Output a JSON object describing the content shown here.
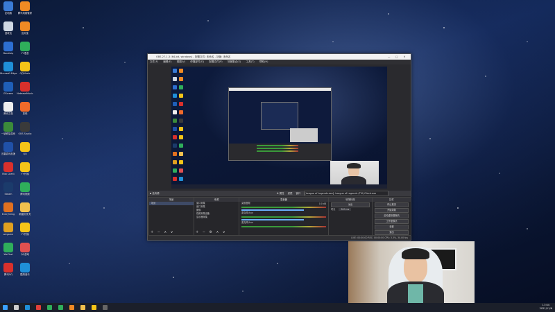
{
  "desktop_icons": [
    {
      "label": "此电脑",
      "icon": "computer-icon",
      "color": "#3a7bd5"
    },
    {
      "label": "腾讯电脑管家",
      "icon": "app-icon",
      "color": "#f08a24"
    },
    {
      "label": "回收站",
      "icon": "recycle-bin-icon",
      "color": "#cfd8e3"
    },
    {
      "label": "应用宝",
      "icon": "app-icon",
      "color": "#f08a24"
    },
    {
      "label": "Bandizip",
      "icon": "archive-icon",
      "color": "#2d6fd2"
    },
    {
      "label": "YY语音",
      "icon": "app-icon",
      "color": "#2fae5b"
    },
    {
      "label": "Microsoft Edge",
      "icon": "edge-icon",
      "color": "#1f8fd8"
    },
    {
      "label": "QQMusic",
      "icon": "music-icon",
      "color": "#f5c518"
    },
    {
      "label": "GScreen",
      "icon": "app-icon",
      "color": "#1f5fb8"
    },
    {
      "label": "NeteaseMusic",
      "icon": "music-icon",
      "color": "#d9302c"
    },
    {
      "label": "腾讯文档",
      "icon": "doc-icon",
      "color": "#eeeeee"
    },
    {
      "label": "剪映",
      "icon": "app-icon",
      "color": "#f06a2a"
    },
    {
      "label": "一键修复游戏",
      "icon": "app-icon",
      "color": "#3b8a3a"
    },
    {
      "label": "OBS Studio",
      "icon": "obs-icon",
      "color": "#3a3a3a"
    },
    {
      "label": "迅雷游戏加速",
      "icon": "app-icon",
      "color": "#2051a8"
    },
    {
      "label": "QQ",
      "icon": "app-icon",
      "color": "#f5c518"
    },
    {
      "label": "Riot Client",
      "icon": "app-icon",
      "color": "#d9302c"
    },
    {
      "label": "YY开播",
      "icon": "app-icon",
      "color": "#f5c518"
    },
    {
      "label": "Steam",
      "icon": "steam-icon",
      "color": "#1b3b6b"
    },
    {
      "label": "腾讯视频",
      "icon": "video-icon",
      "color": "#2fae5b"
    },
    {
      "label": "Everything",
      "icon": "search-icon",
      "color": "#e07020"
    },
    {
      "label": "新建文件夹",
      "icon": "folder-icon",
      "color": "#f2c14e"
    },
    {
      "label": "wegame",
      "icon": "app-icon",
      "color": "#e0a020"
    },
    {
      "label": "YY开播",
      "icon": "app-icon",
      "color": "#f5c518"
    },
    {
      "label": "WeChat",
      "icon": "wechat-icon",
      "color": "#2fae5b"
    },
    {
      "label": "QQ游戏",
      "icon": "app-icon",
      "color": "#e05050"
    },
    {
      "label": "腾讯QQ",
      "icon": "app-icon",
      "color": "#d9302c"
    },
    {
      "label": "酷狗音乐",
      "icon": "music-icon",
      "color": "#1f8fd8"
    }
  ],
  "obs": {
    "title": "OBS 27.1.3 (64-bit, windows) - 配置文件: 未命名 - 场景: 未命名",
    "window_buttons": [
      "—",
      "□",
      "✕"
    ],
    "menu": [
      "文件(F)",
      "编辑(E)",
      "视图(V)",
      "停靠部件(D)",
      "配置文件(P)",
      "场景集合(S)",
      "工具(T)",
      "帮助(H)"
    ],
    "scene_bar": {
      "left": "▪ 没有源",
      "props": "⚙ 属性",
      "filters": "滤镜",
      "window": "窗口",
      "window_value": "[League of Legends.exe]: League of Legends (TM) Client.exe"
    },
    "docks": {
      "scenes": {
        "title": "场景",
        "items": [
          "场景"
        ],
        "foot": "+ − ∧ ∨"
      },
      "sources": {
        "title": "来源",
        "items": [
          "窗口采集",
          "窗口采集",
          "图像",
          "视频采集设备",
          "显示器采集"
        ],
        "foot": "+ − ⚙ ∧ ∨"
      },
      "mixer": {
        "title": "混音器",
        "channels": [
          "桌面音频",
          "麦克风/Aux",
          "麦克风/Aux"
        ],
        "db": "0.0 dB"
      },
      "transitions": {
        "title": "转场特效",
        "type": "淡出",
        "duration_label": "时长",
        "duration": "300 ms"
      },
      "controls": {
        "title": "控件",
        "buttons": [
          "停止推流",
          "开始录制",
          "启动虚拟摄像机",
          "工作室模式",
          "设置",
          "退出"
        ]
      }
    },
    "status": "LIVE: 00:00:00   REC: 00:00:00   CPU: 3.3%, 30.00 fps"
  },
  "taskbar": {
    "time": "17:04",
    "date": "2021/11/6",
    "items": [
      {
        "icon": "windows-icon",
        "color": "#3aa0ff"
      },
      {
        "icon": "search-icon",
        "color": "#cccccc"
      },
      {
        "icon": "edge-icon",
        "color": "#1f8fd8"
      },
      {
        "icon": "chrome-icon",
        "color": "#e0403a"
      },
      {
        "icon": "wechat-icon",
        "color": "#2fae5b"
      },
      {
        "icon": "app-icon",
        "color": "#2fae5b"
      },
      {
        "icon": "app-icon",
        "color": "#f08a24"
      },
      {
        "icon": "folder-icon",
        "color": "#f2c14e"
      },
      {
        "icon": "app-icon",
        "color": "#f5c518"
      },
      {
        "icon": "obs-icon",
        "color": "#666666"
      }
    ]
  }
}
